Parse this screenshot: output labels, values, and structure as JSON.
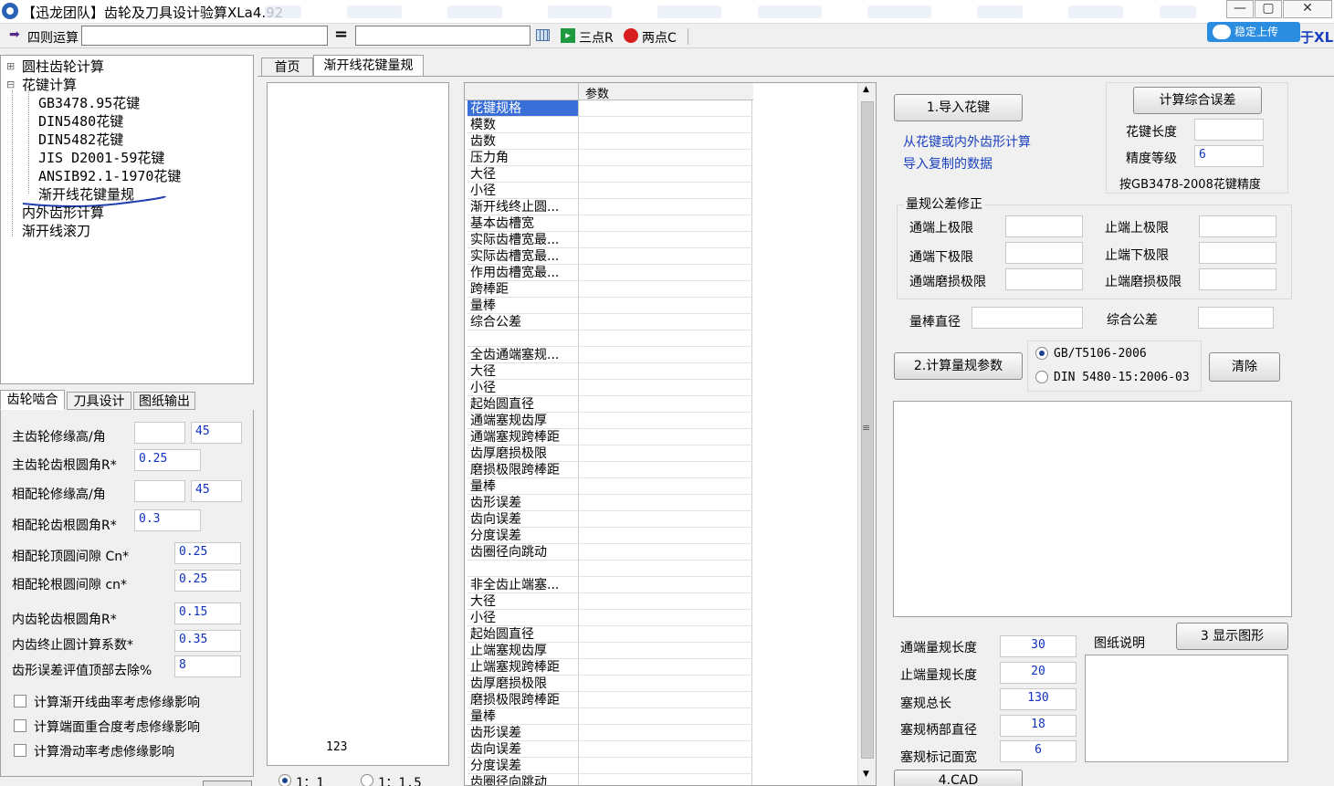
{
  "window": {
    "title": "【迅龙团队】齿轮及刀具设计验算XLa4.92",
    "min": "—",
    "max": "▢",
    "close": "✕"
  },
  "toolbar": {
    "calc_label": "四则运算",
    "equals": "=",
    "three_point": "三点R",
    "two_point": "两点C",
    "right_text": "于XL",
    "cloud_label": "稳定上传"
  },
  "tree": {
    "items": [
      {
        "label": "圆柱齿轮计算",
        "expander": "⊞"
      },
      {
        "label": "花键计算",
        "expander": "⊟"
      },
      {
        "label": "GB3478.95花键"
      },
      {
        "label": "DIN5480花键"
      },
      {
        "label": "DIN5482花键"
      },
      {
        "label": "JIS D2001-59花键"
      },
      {
        "label": "ANSIB92.1-1970花键"
      },
      {
        "label": "渐开线花键量规"
      },
      {
        "label": "内外齿形计算"
      },
      {
        "label": "渐开线滚刀"
      }
    ]
  },
  "left_tabs": [
    "齿轮啮合",
    "刀具设计",
    "图纸输出"
  ],
  "left_form": {
    "rows": [
      {
        "label": "主齿轮修缘高/角",
        "v1": "",
        "v2": "45"
      },
      {
        "label": "主齿轮齿根圆角R*",
        "v1": "0.25"
      },
      {
        "label": "相配轮修缘高/角",
        "v1": "",
        "v2": "45"
      },
      {
        "label": "相配轮齿根圆角R*",
        "v1": "0.3"
      },
      {
        "label": "相配轮顶圆间隙  Cn*",
        "v1": "0.25"
      },
      {
        "label": "相配轮根圆间隙  cn*",
        "v1": "0.25"
      },
      {
        "label": "内齿轮齿根圆角R*",
        "v1": "0.15"
      },
      {
        "label": "内齿终止圆计算系数*",
        "v1": "0.35"
      },
      {
        "label": "齿形误差评值顶部去除%",
        "v1": "8"
      }
    ],
    "checks": [
      "计算渐开线曲率考虑修缘影响",
      "计算端面重合度考虑修缘影响",
      "计算滑动率考虑修缘影响"
    ]
  },
  "main_tabs": [
    "首页",
    "渐开线花键量规"
  ],
  "preview": {
    "number": "123",
    "scale1": "1：1",
    "scale2": "1：1.5"
  },
  "grid": {
    "header": "参数",
    "rows": [
      "花键规格",
      "模数",
      "齿数",
      "压力角",
      "大径",
      "小径",
      "渐开线终止圆...",
      "基本齿槽宽",
      "实际齿槽宽最...",
      "实际齿槽宽最...",
      "作用齿槽宽最...",
      "跨棒距",
      "量棒",
      "综合公差",
      "",
      "全齿通端塞规...",
      "大径",
      "小径",
      "起始圆直径",
      "通端塞规齿厚",
      "通端塞规跨棒距",
      "齿厚磨损极限",
      "磨损极限跨棒距",
      "量棒",
      "齿形误差",
      "齿向误差",
      "分度误差",
      "齿圈径向跳动",
      "",
      "非全齿止端塞...",
      "大径",
      "小径",
      "起始圆直径",
      "止端塞规齿厚",
      "止端塞规跨棒距",
      "齿厚磨损极限",
      "磨损极限跨棒距",
      "量棒",
      "齿形误差",
      "齿向误差",
      "分度误差",
      "齿圈径向跳动"
    ],
    "splitter": "≡"
  },
  "right": {
    "import_btn": "1.导入花键",
    "import_desc1": "从花键或内外齿形计算",
    "import_desc2": "导入复制的数据",
    "calc_err_btn": "计算综合误差",
    "spline_len_label": "花键长度",
    "spline_len": "",
    "precision_label": "精度等级",
    "precision": "6",
    "precision_note": "按GB3478-2008花键精度",
    "tol_group": "量规公差修正",
    "tol": [
      {
        "label": "通端上极限",
        "value": ""
      },
      {
        "label": "止端上极限",
        "value": ""
      },
      {
        "label": "通端下极限",
        "value": ""
      },
      {
        "label": "止端下极限",
        "value": ""
      },
      {
        "label": "通端磨损极限",
        "value": ""
      },
      {
        "label": "止端磨损极限",
        "value": ""
      }
    ],
    "rod_label": "量棒直径",
    "rod": "",
    "total_tol_label": "综合公差",
    "total_tol": "",
    "calc_btn": "2.计算量规参数",
    "std1": "GB/T5106-2006",
    "std2": "DIN 5480-15:2006-03",
    "clear_btn": "清除",
    "bottom": [
      {
        "label": "通端量规长度",
        "value": "30"
      },
      {
        "label": "止端量规长度",
        "value": "20"
      },
      {
        "label": "塞规总长",
        "value": "130"
      },
      {
        "label": "塞规柄部直径",
        "value": "18"
      },
      {
        "label": "塞规标记面宽",
        "value": "6"
      }
    ],
    "drawing_note_label": "图纸说明",
    "show_btn": "3 显示图形",
    "cad_btn": "4.CAD"
  },
  "colors": {
    "selection": "#3a6fd8",
    "value_text": "#1030c0",
    "link_text": "#1a3fc0"
  }
}
